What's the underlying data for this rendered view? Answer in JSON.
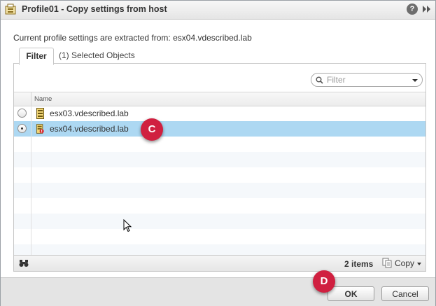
{
  "window": {
    "title": "Profile01 - Copy settings from host",
    "help_label": "?"
  },
  "content": {
    "extract_text": "Current profile settings are extracted from: esx04.vdescribed.lab",
    "tabs": [
      {
        "label": "Filter",
        "active": true
      },
      {
        "label": "(1) Selected Objects",
        "active": false
      }
    ],
    "filter": {
      "placeholder": "Filter"
    },
    "grid": {
      "columns": [
        "Name"
      ],
      "rows": [
        {
          "name": "esx03.vdescribed.lab",
          "selected": false,
          "icon": "host-icon"
        },
        {
          "name": "esx04.vdescribed.lab",
          "selected": true,
          "icon": "host-warning-icon"
        }
      ],
      "items_count": "2 items",
      "copy_label": "Copy"
    }
  },
  "footer": {
    "ok_label": "OK",
    "cancel_label": "Cancel"
  },
  "annotations": [
    {
      "label": "C"
    },
    {
      "label": "D"
    }
  ],
  "colors": {
    "selection": "#add8f2",
    "badge": "#d02040",
    "accent_tab_border": "#c6c6c6"
  }
}
